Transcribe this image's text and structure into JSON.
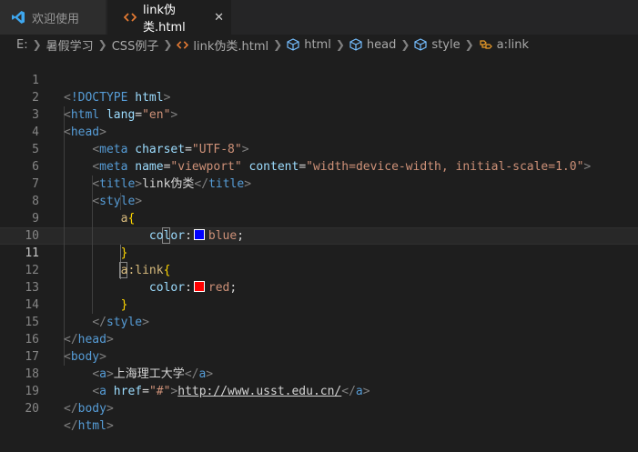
{
  "tabs": [
    {
      "label": "欢迎使用",
      "icon": "vscode-icon",
      "active": false
    },
    {
      "label": "link伪类.html",
      "icon": "html-file-icon",
      "active": true,
      "close": "✕"
    }
  ],
  "breadcrumb": [
    "E:",
    "暑假学习",
    "CSS例子",
    "link伪类.html",
    "html",
    "head",
    "style",
    "a:link"
  ],
  "colors": {
    "blue_swatch": "#0000ff",
    "red_swatch": "#ff0000",
    "accent": "#007acc"
  },
  "lines": [
    {
      "n": "1"
    },
    {
      "n": "2"
    },
    {
      "n": "3"
    },
    {
      "n": "4"
    },
    {
      "n": "5"
    },
    {
      "n": "6"
    },
    {
      "n": "7"
    },
    {
      "n": "8"
    },
    {
      "n": "9"
    },
    {
      "n": "10"
    },
    {
      "n": "11"
    },
    {
      "n": "12"
    },
    {
      "n": "13"
    },
    {
      "n": "14"
    },
    {
      "n": "15"
    },
    {
      "n": "16"
    },
    {
      "n": "17"
    },
    {
      "n": "18"
    },
    {
      "n": "19"
    },
    {
      "n": "20"
    }
  ],
  "code": {
    "doctype": "!DOCTYPE",
    "doctype_val": "html",
    "html": "html",
    "lang": "lang",
    "lang_val": "\"en\"",
    "head": "head",
    "meta": "meta",
    "charset": "charset",
    "charset_val": "\"UTF-8\"",
    "name": "name",
    "name_val": "\"viewport\"",
    "content": "content",
    "content_val": "\"width=device-width, initial-scale=1.0\"",
    "title": "title",
    "title_text": "link伪类",
    "style": "style",
    "sel_a": "a",
    "prop_color": "color",
    "val_blue": "blue",
    "sel_alink": "a:link",
    "val_red": "red",
    "body": "body",
    "a": "a",
    "a1_text": "上海理工大学",
    "href": "href",
    "href_val": "\"#\"",
    "a2_text": "http://www.usst.edu.cn/"
  }
}
